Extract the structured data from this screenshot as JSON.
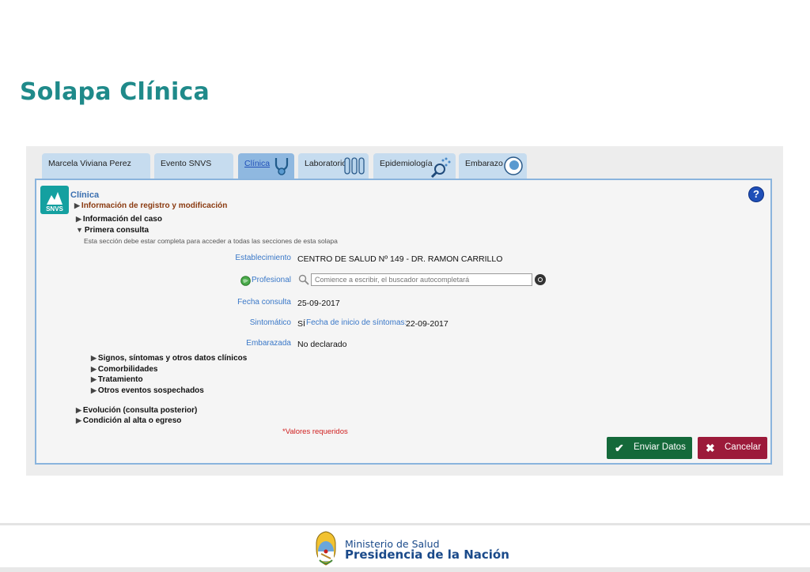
{
  "slide_title": "Solapa Clínica",
  "tabs": [
    {
      "label": "Marcela Viviana Perez",
      "active": false
    },
    {
      "label": "Evento SNVS",
      "active": false
    },
    {
      "label": "Clínica",
      "active": true
    },
    {
      "label": "Laboratorio",
      "active": false
    },
    {
      "label": "Epidemiología",
      "active": false
    },
    {
      "label": "Embarazo",
      "active": false
    }
  ],
  "panel": {
    "logo_text": "SNVS",
    "title": "Clínica",
    "help": "?",
    "info_registro": "Información de registro y modificación",
    "info_caso": "Información del caso",
    "primera_consulta": "Primera consulta",
    "notice": "Esta sección debe estar completa para acceder a todas las secciones de esta solapa"
  },
  "form": {
    "establecimiento_label": "Establecimiento",
    "establecimiento_value": "CENTRO DE SALUD Nº 149 - DR. RAMON CARRILLO",
    "profesional_label": "Profesional",
    "profesional_placeholder": "Comience a escribir, el buscador autocompletará",
    "fecha_consulta_label": "Fecha consulta",
    "fecha_consulta_value": "25-09-2017",
    "sintomatico_label": "Sintomático",
    "sintomatico_value": "SÍ",
    "fecha_inicio_label": "Fecha de inicio de síntomas:",
    "fecha_inicio_value": "22-09-2017",
    "embarazada_label": "Embarazada",
    "embarazada_value": "No declarado"
  },
  "subsections": [
    "Signos, síntomas y otros datos clínicos",
    "Comorbilidades",
    "Tratamiento",
    "Otros eventos sospechados"
  ],
  "sections": [
    "Evolución (consulta posterior)",
    "Condición al alta o egreso"
  ],
  "required_note": "*Valores requeridos",
  "buttons": {
    "send": "Enviar Datos",
    "cancel": "Cancelar"
  },
  "footer": {
    "line1": "Ministerio de Salud",
    "line2": "Presidencia de la Nación"
  },
  "colors": {
    "title": "#1f8a8a",
    "send": "#14693a",
    "cancel": "#9c1a3a",
    "required": "#d02020"
  }
}
